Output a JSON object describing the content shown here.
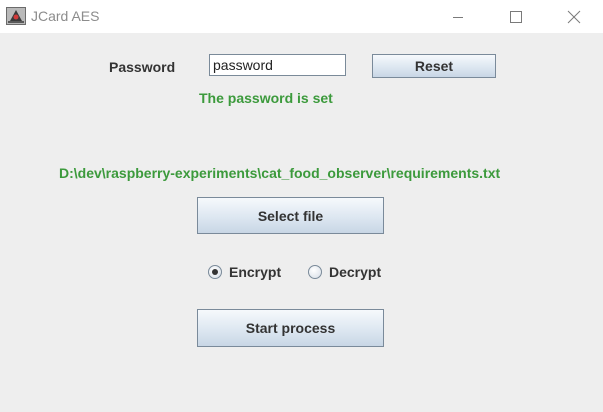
{
  "window": {
    "title": "JCard AES",
    "icon": "java-app-icon"
  },
  "password": {
    "label": "Password",
    "value": "password",
    "status": "The password is set",
    "reset_label": "Reset"
  },
  "file": {
    "path": "D:\\dev\\raspberry-experiments\\cat_food_observer\\requirements.txt",
    "select_label": "Select file"
  },
  "mode": {
    "options": [
      {
        "label": "Encrypt",
        "selected": true
      },
      {
        "label": "Decrypt",
        "selected": false
      }
    ]
  },
  "actions": {
    "start_label": "Start process"
  },
  "colors": {
    "status_green": "#3c9a3c",
    "background": "#eeeeee"
  }
}
